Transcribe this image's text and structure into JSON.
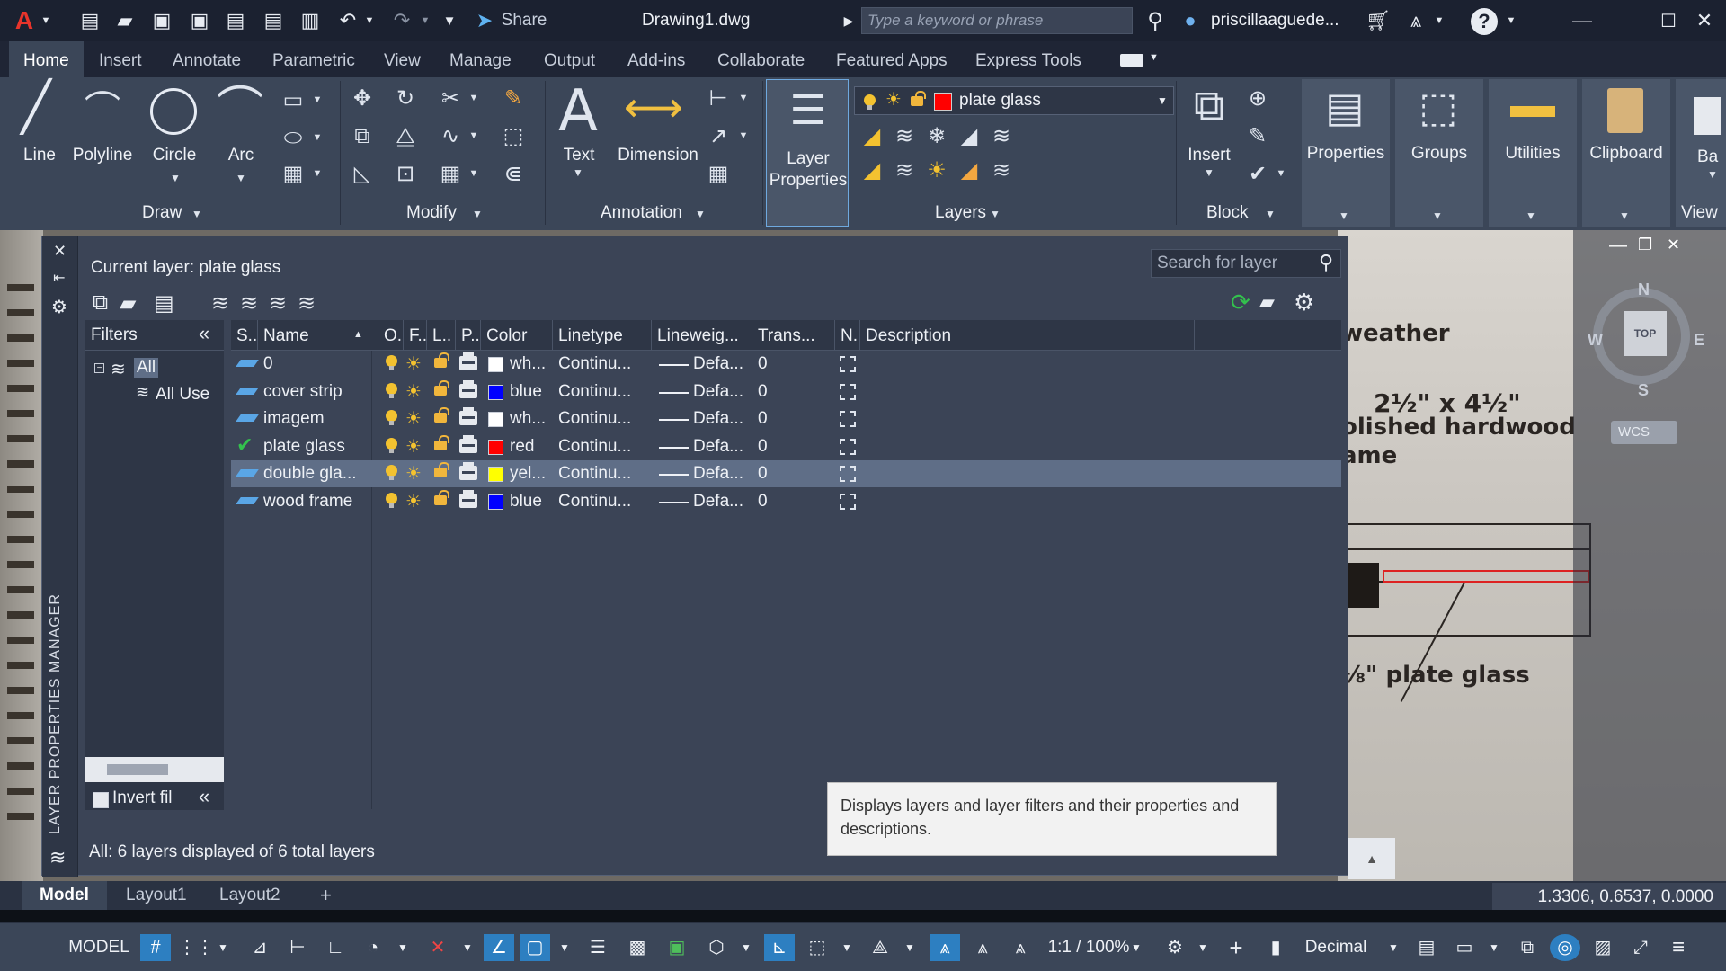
{
  "app": {
    "document_title": "Drawing1.dwg",
    "share_label": "Share",
    "search_placeholder": "Type a keyword or phrase",
    "user_name": "priscillaaguede..."
  },
  "ribbon_tabs": [
    "Home",
    "Insert",
    "Annotate",
    "Parametric",
    "View",
    "Manage",
    "Output",
    "Add-ins",
    "Collaborate",
    "Featured Apps",
    "Express Tools"
  ],
  "ribbon": {
    "draw": {
      "title": "Draw",
      "tools": [
        "Line",
        "Polyline",
        "Circle",
        "Arc"
      ]
    },
    "modify": {
      "title": "Modify"
    },
    "annotation": {
      "title": "Annotation",
      "tools": [
        "Text",
        "Dimension"
      ]
    },
    "layer_properties_label": "Layer Properties",
    "layers": {
      "title": "Layers",
      "current_layer": "plate glass",
      "current_color": "#ff0000"
    },
    "block": {
      "title": "Block",
      "insert_label": "Insert"
    },
    "properties_label": "Properties",
    "groups_label": "Groups",
    "utilities_label": "Utilities",
    "clipboard_label": "Clipboard",
    "view_label": "View",
    "view_partial_label": "Ba"
  },
  "palette": {
    "side_title": "LAYER PROPERTIES MANAGER",
    "current_layer_text": "Current layer: plate glass",
    "search_placeholder": "Search for layer",
    "filters_title": "Filters",
    "tree": {
      "all": "All",
      "all_used": "All Use"
    },
    "invert_filter_label": "Invert fil",
    "columns": {
      "status": "S..",
      "name": "Name",
      "on": "O..",
      "freeze": "F..",
      "lock": "L..",
      "plot": "P..",
      "color": "Color",
      "linetype": "Linetype",
      "lineweight": "Lineweig...",
      "transparency": "Trans...",
      "new_vp": "N..",
      "description": "Description"
    },
    "layers": [
      {
        "name": "0",
        "color_name": "wh...",
        "color": "#ffffff",
        "linetype": "Continu...",
        "lineweight": "Defa...",
        "transparency": "0",
        "current": false,
        "selected": false
      },
      {
        "name": "cover strip",
        "color_name": "blue",
        "color": "#0000ff",
        "linetype": "Continu...",
        "lineweight": "Defa...",
        "transparency": "0",
        "current": false,
        "selected": false
      },
      {
        "name": "imagem",
        "color_name": "wh...",
        "color": "#ffffff",
        "linetype": "Continu...",
        "lineweight": "Defa...",
        "transparency": "0",
        "current": false,
        "selected": false
      },
      {
        "name": "plate glass",
        "color_name": "red",
        "color": "#ff0000",
        "linetype": "Continu...",
        "lineweight": "Defa...",
        "transparency": "0",
        "current": true,
        "selected": false
      },
      {
        "name": "double gla...",
        "color_name": "yel...",
        "color": "#ffff00",
        "linetype": "Continu...",
        "lineweight": "Defa...",
        "transparency": "0",
        "current": false,
        "selected": true
      },
      {
        "name": "wood frame",
        "color_name": "blue",
        "color": "#0000ff",
        "linetype": "Continu...",
        "lineweight": "Defa...",
        "transparency": "0",
        "current": false,
        "selected": false
      }
    ],
    "status_text": "All: 6 layers displayed of 6 total layers",
    "tooltip": "Displays layers and layer filters and their properties and descriptions."
  },
  "viewcube": {
    "north": "N",
    "south": "S",
    "east": "E",
    "west": "W",
    "face": "TOP",
    "ucs": "WCS"
  },
  "drawing_annotations": [
    "weather",
    "2½\" x 4½\"",
    "olished hardwood",
    "ame",
    "⅛\" plate glass"
  ],
  "layout_tabs": [
    "Model",
    "Layout1",
    "Layout2"
  ],
  "coordinates": "1.3306, 0.6537, 0.0000",
  "statusbar": {
    "model_label": "MODEL",
    "scale_label": "1:1 / 100%",
    "units_label": "Decimal"
  }
}
